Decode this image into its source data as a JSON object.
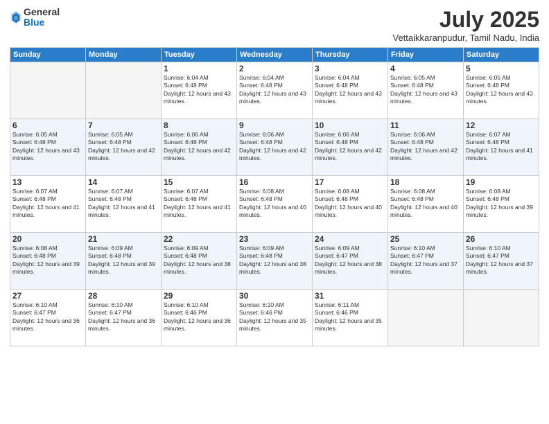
{
  "header": {
    "logo_general": "General",
    "logo_blue": "Blue",
    "month_title": "July 2025",
    "location": "Vettaikkaranpudur, Tamil Nadu, India"
  },
  "weekdays": [
    "Sunday",
    "Monday",
    "Tuesday",
    "Wednesday",
    "Thursday",
    "Friday",
    "Saturday"
  ],
  "weeks": [
    [
      {
        "day": "",
        "empty": true
      },
      {
        "day": "",
        "empty": true
      },
      {
        "day": "1",
        "sunrise": "Sunrise: 6:04 AM",
        "sunset": "Sunset: 6:48 PM",
        "daylight": "Daylight: 12 hours and 43 minutes."
      },
      {
        "day": "2",
        "sunrise": "Sunrise: 6:04 AM",
        "sunset": "Sunset: 6:48 PM",
        "daylight": "Daylight: 12 hours and 43 minutes."
      },
      {
        "day": "3",
        "sunrise": "Sunrise: 6:04 AM",
        "sunset": "Sunset: 6:48 PM",
        "daylight": "Daylight: 12 hours and 43 minutes."
      },
      {
        "day": "4",
        "sunrise": "Sunrise: 6:05 AM",
        "sunset": "Sunset: 6:48 PM",
        "daylight": "Daylight: 12 hours and 43 minutes."
      },
      {
        "day": "5",
        "sunrise": "Sunrise: 6:05 AM",
        "sunset": "Sunset: 6:48 PM",
        "daylight": "Daylight: 12 hours and 43 minutes."
      }
    ],
    [
      {
        "day": "6",
        "sunrise": "Sunrise: 6:05 AM",
        "sunset": "Sunset: 6:48 PM",
        "daylight": "Daylight: 12 hours and 43 minutes."
      },
      {
        "day": "7",
        "sunrise": "Sunrise: 6:05 AM",
        "sunset": "Sunset: 6:48 PM",
        "daylight": "Daylight: 12 hours and 42 minutes."
      },
      {
        "day": "8",
        "sunrise": "Sunrise: 6:06 AM",
        "sunset": "Sunset: 6:48 PM",
        "daylight": "Daylight: 12 hours and 42 minutes."
      },
      {
        "day": "9",
        "sunrise": "Sunrise: 6:06 AM",
        "sunset": "Sunset: 6:48 PM",
        "daylight": "Daylight: 12 hours and 42 minutes."
      },
      {
        "day": "10",
        "sunrise": "Sunrise: 6:06 AM",
        "sunset": "Sunset: 6:48 PM",
        "daylight": "Daylight: 12 hours and 42 minutes."
      },
      {
        "day": "11",
        "sunrise": "Sunrise: 6:06 AM",
        "sunset": "Sunset: 6:48 PM",
        "daylight": "Daylight: 12 hours and 42 minutes."
      },
      {
        "day": "12",
        "sunrise": "Sunrise: 6:07 AM",
        "sunset": "Sunset: 6:48 PM",
        "daylight": "Daylight: 12 hours and 41 minutes."
      }
    ],
    [
      {
        "day": "13",
        "sunrise": "Sunrise: 6:07 AM",
        "sunset": "Sunset: 6:48 PM",
        "daylight": "Daylight: 12 hours and 41 minutes."
      },
      {
        "day": "14",
        "sunrise": "Sunrise: 6:07 AM",
        "sunset": "Sunset: 6:48 PM",
        "daylight": "Daylight: 12 hours and 41 minutes."
      },
      {
        "day": "15",
        "sunrise": "Sunrise: 6:07 AM",
        "sunset": "Sunset: 6:48 PM",
        "daylight": "Daylight: 12 hours and 41 minutes."
      },
      {
        "day": "16",
        "sunrise": "Sunrise: 6:08 AM",
        "sunset": "Sunset: 6:48 PM",
        "daylight": "Daylight: 12 hours and 40 minutes."
      },
      {
        "day": "17",
        "sunrise": "Sunrise: 6:08 AM",
        "sunset": "Sunset: 6:48 PM",
        "daylight": "Daylight: 12 hours and 40 minutes."
      },
      {
        "day": "18",
        "sunrise": "Sunrise: 6:08 AM",
        "sunset": "Sunset: 6:48 PM",
        "daylight": "Daylight: 12 hours and 40 minutes."
      },
      {
        "day": "19",
        "sunrise": "Sunrise: 6:08 AM",
        "sunset": "Sunset: 6:48 PM",
        "daylight": "Daylight: 12 hours and 39 minutes."
      }
    ],
    [
      {
        "day": "20",
        "sunrise": "Sunrise: 6:08 AM",
        "sunset": "Sunset: 6:48 PM",
        "daylight": "Daylight: 12 hours and 39 minutes."
      },
      {
        "day": "21",
        "sunrise": "Sunrise: 6:09 AM",
        "sunset": "Sunset: 6:48 PM",
        "daylight": "Daylight: 12 hours and 39 minutes."
      },
      {
        "day": "22",
        "sunrise": "Sunrise: 6:09 AM",
        "sunset": "Sunset: 6:48 PM",
        "daylight": "Daylight: 12 hours and 38 minutes."
      },
      {
        "day": "23",
        "sunrise": "Sunrise: 6:09 AM",
        "sunset": "Sunset: 6:48 PM",
        "daylight": "Daylight: 12 hours and 38 minutes."
      },
      {
        "day": "24",
        "sunrise": "Sunrise: 6:09 AM",
        "sunset": "Sunset: 6:47 PM",
        "daylight": "Daylight: 12 hours and 38 minutes."
      },
      {
        "day": "25",
        "sunrise": "Sunrise: 6:10 AM",
        "sunset": "Sunset: 6:47 PM",
        "daylight": "Daylight: 12 hours and 37 minutes."
      },
      {
        "day": "26",
        "sunrise": "Sunrise: 6:10 AM",
        "sunset": "Sunset: 6:47 PM",
        "daylight": "Daylight: 12 hours and 37 minutes."
      }
    ],
    [
      {
        "day": "27",
        "sunrise": "Sunrise: 6:10 AM",
        "sunset": "Sunset: 6:47 PM",
        "daylight": "Daylight: 12 hours and 36 minutes."
      },
      {
        "day": "28",
        "sunrise": "Sunrise: 6:10 AM",
        "sunset": "Sunset: 6:47 PM",
        "daylight": "Daylight: 12 hours and 36 minutes."
      },
      {
        "day": "29",
        "sunrise": "Sunrise: 6:10 AM",
        "sunset": "Sunset: 6:46 PM",
        "daylight": "Daylight: 12 hours and 36 minutes."
      },
      {
        "day": "30",
        "sunrise": "Sunrise: 6:10 AM",
        "sunset": "Sunset: 6:46 PM",
        "daylight": "Daylight: 12 hours and 35 minutes."
      },
      {
        "day": "31",
        "sunrise": "Sunrise: 6:11 AM",
        "sunset": "Sunset: 6:46 PM",
        "daylight": "Daylight: 12 hours and 35 minutes."
      },
      {
        "day": "",
        "empty": true
      },
      {
        "day": "",
        "empty": true
      }
    ]
  ]
}
